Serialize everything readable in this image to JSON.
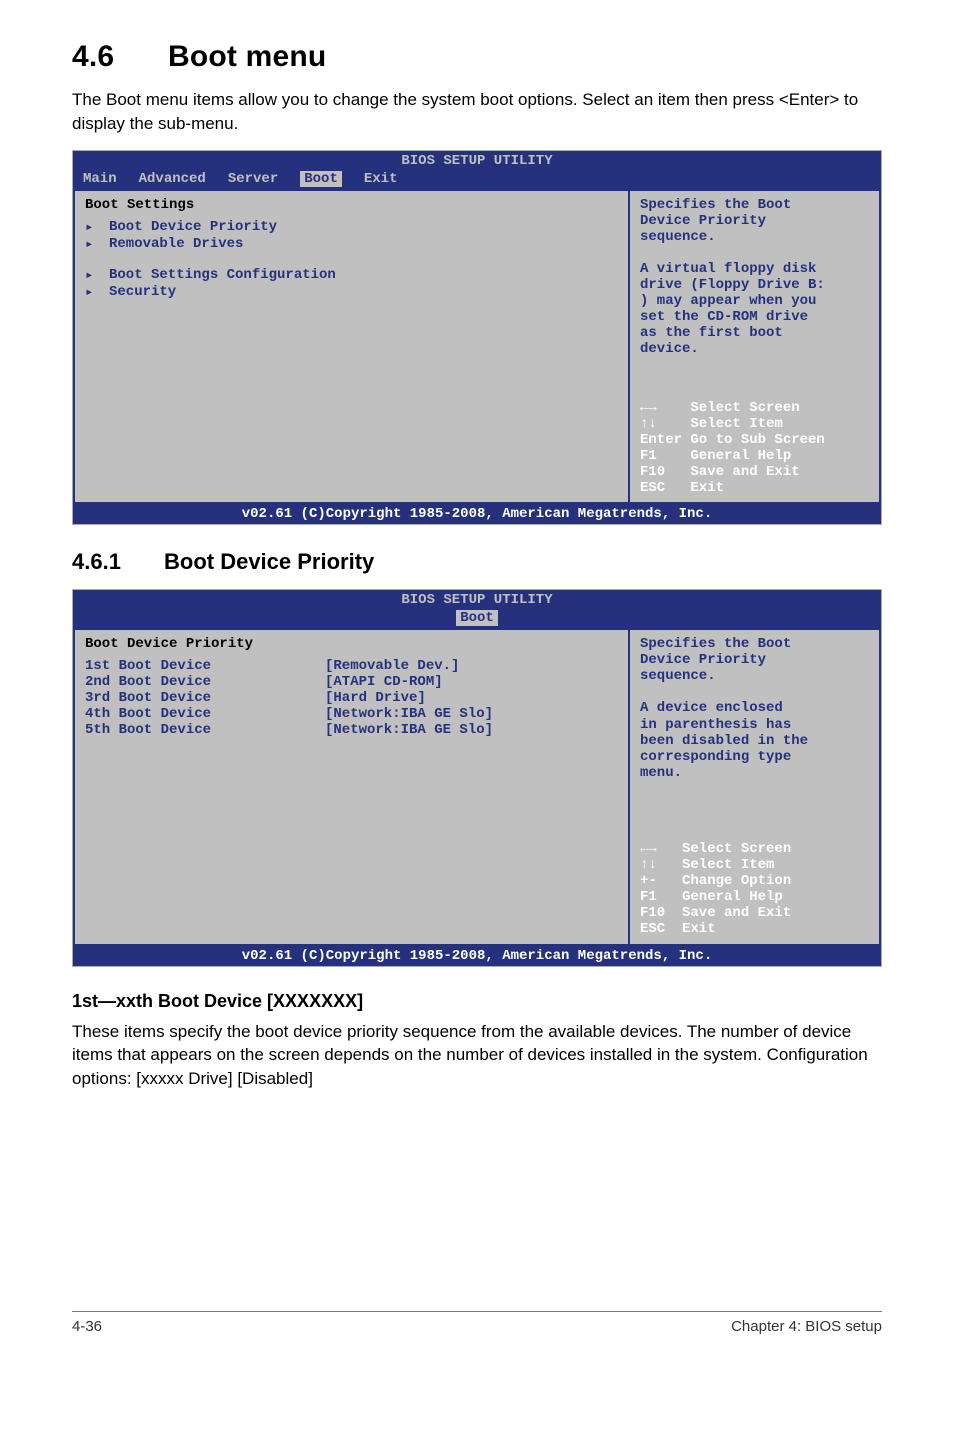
{
  "doc": {
    "h1_num": "4.6",
    "h1_title": "Boot menu",
    "intro": "The Boot menu items allow you to change the system boot options. Select an item then press <Enter> to display the sub-menu.",
    "h2_num": "4.6.1",
    "h2_title": "Boot Device Priority",
    "h3": "1st—xxth Boot Device [XXXXXXX]",
    "body2": "These items specify the boot device priority sequence from the available devices. The number of device items that appears on the screen depends on the number of devices installed in the system. Configuration options: [xxxxx Drive] [Disabled]",
    "footer_left": "4-36",
    "footer_right": "Chapter 4: BIOS setup"
  },
  "bios1": {
    "title": "BIOS SETUP UTILITY",
    "tabs": {
      "main": "Main",
      "advanced": "Advanced",
      "server": "Server",
      "boot": "Boot",
      "exit": "Exit"
    },
    "section": "Boot Settings",
    "items": {
      "i0": "Boot Device Priority",
      "i1": "Removable Drives",
      "i2": "Boot Settings Configuration",
      "i3": "Security"
    },
    "help": "Specifies the Boot\nDevice Priority\nsequence.\n\nA virtual floppy disk\ndrive (Floppy Drive B:\n) may appear when you\nset the CD-ROM drive\nas the first boot\ndevice.",
    "nav": "←→    Select Screen\n↑↓    Select Item\nEnter Go to Sub Screen\nF1    General Help\nF10   Save and Exit\nESC   Exit",
    "copyright": "v02.61 (C)Copyright 1985-2008, American Megatrends, Inc."
  },
  "bios2": {
    "title": "BIOS SETUP UTILITY",
    "tab": "Boot",
    "section": "Boot Device Priority",
    "rows": {
      "r0": {
        "label": "1st Boot Device",
        "value": "[Removable Dev.]"
      },
      "r1": {
        "label": "2nd Boot Device",
        "value": "[ATAPI CD-ROM]"
      },
      "r2": {
        "label": "3rd Boot Device",
        "value": "[Hard Drive]"
      },
      "r3": {
        "label": "4th Boot Device",
        "value": "[Network:IBA GE Slo]"
      },
      "r4": {
        "label": "5th Boot Device",
        "value": "[Network:IBA GE Slo]"
      }
    },
    "help": "Specifies the Boot\nDevice Priority\nsequence.\n\nA device enclosed\nin parenthesis has\nbeen disabled in the\ncorresponding type\nmenu.",
    "nav": "←→   Select Screen\n↑↓   Select Item\n+-   Change Option\nF1   General Help\nF10  Save and Exit\nESC  Exit",
    "copyright": "v02.61 (C)Copyright 1985-2008, American Megatrends, Inc."
  }
}
